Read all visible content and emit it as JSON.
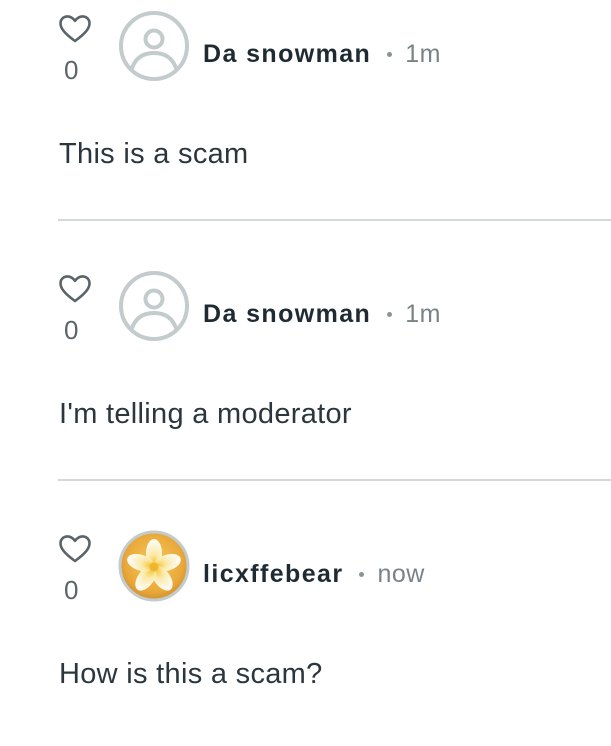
{
  "comments": [
    {
      "like_count": "0",
      "username": "Da snowman",
      "timestamp": "1m",
      "text": "This is a scam",
      "avatar_icon": "default-user-icon"
    },
    {
      "like_count": "0",
      "username": "Da snowman",
      "timestamp": "1m",
      "text": "I'm telling a moderator",
      "avatar_icon": "default-user-icon"
    },
    {
      "like_count": "0",
      "username": "licxffebear",
      "timestamp": "now",
      "text": "How is this a scam?",
      "avatar_icon": "plumeria-flower-avatar"
    }
  ],
  "colors": {
    "icon_gray": "#5b6468",
    "avatar_gray": "#c3cbcc",
    "divider": "#d3d9da",
    "username": "#1f2a33",
    "text": "#2c363d"
  }
}
